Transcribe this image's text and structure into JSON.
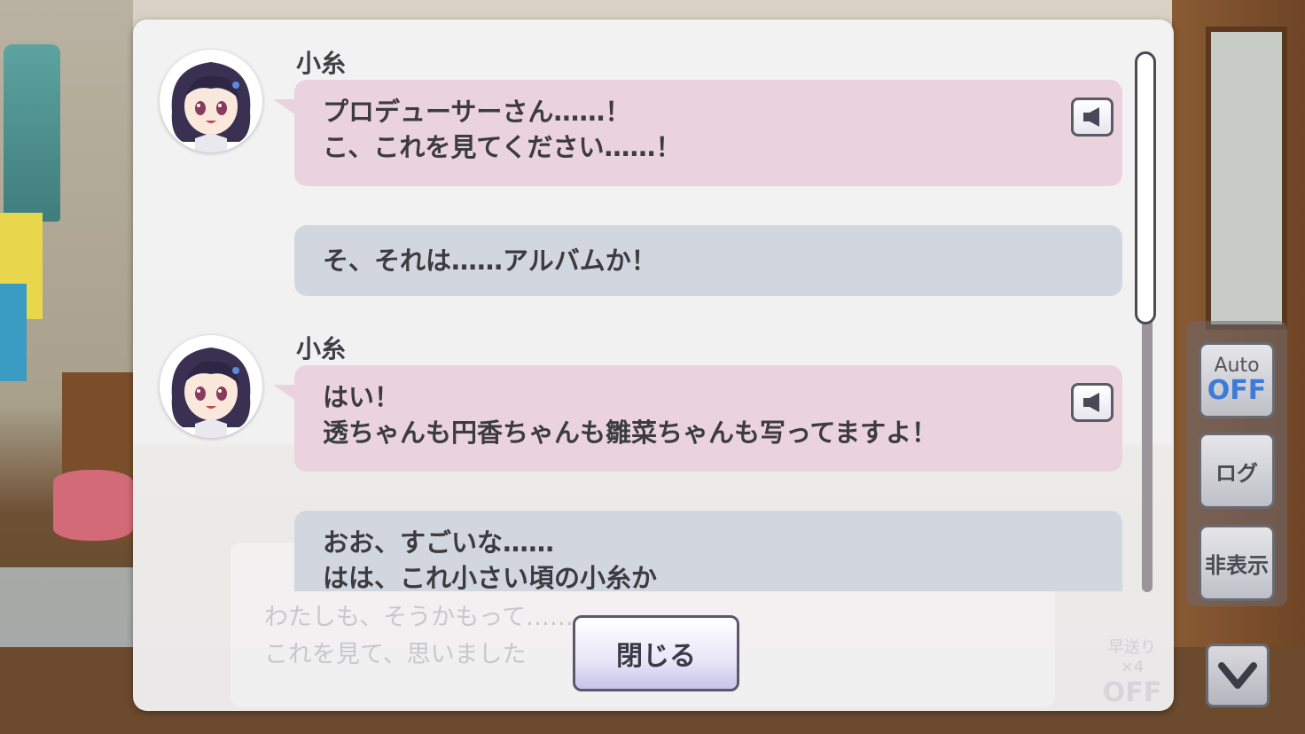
{
  "log": {
    "messages": [
      {
        "type": "character",
        "speaker": "小糸",
        "lines": [
          "プロデューサーさん……！",
          "こ、これを見てください……！"
        ],
        "has_voice": true
      },
      {
        "type": "player",
        "lines": [
          "そ、それは……アルバムか！"
        ]
      },
      {
        "type": "character",
        "speaker": "小糸",
        "lines": [
          "はい！",
          "透ちゃんも円香ちゃんも雛菜ちゃんも写ってますよ！"
        ],
        "has_voice": true
      },
      {
        "type": "player",
        "lines": [
          "おお、すごいな……",
          "はは、これ小さい頃の小糸か"
        ]
      }
    ]
  },
  "close_button": {
    "label": "閉じる"
  },
  "background_textbox": {
    "lines": [
      "わたしも、そうかもって……",
      "これを見て、思いました"
    ],
    "speed_label": "早送り×4",
    "speed_value": "OFF"
  },
  "side_controls": {
    "auto_label": "Auto",
    "auto_state": "OFF",
    "log_label": "ログ",
    "hide_label": "非表示"
  },
  "colors": {
    "character_bubble": "#ead3dd",
    "player_bubble": "#d2d6de",
    "auto_state": "#3d7bd8"
  }
}
